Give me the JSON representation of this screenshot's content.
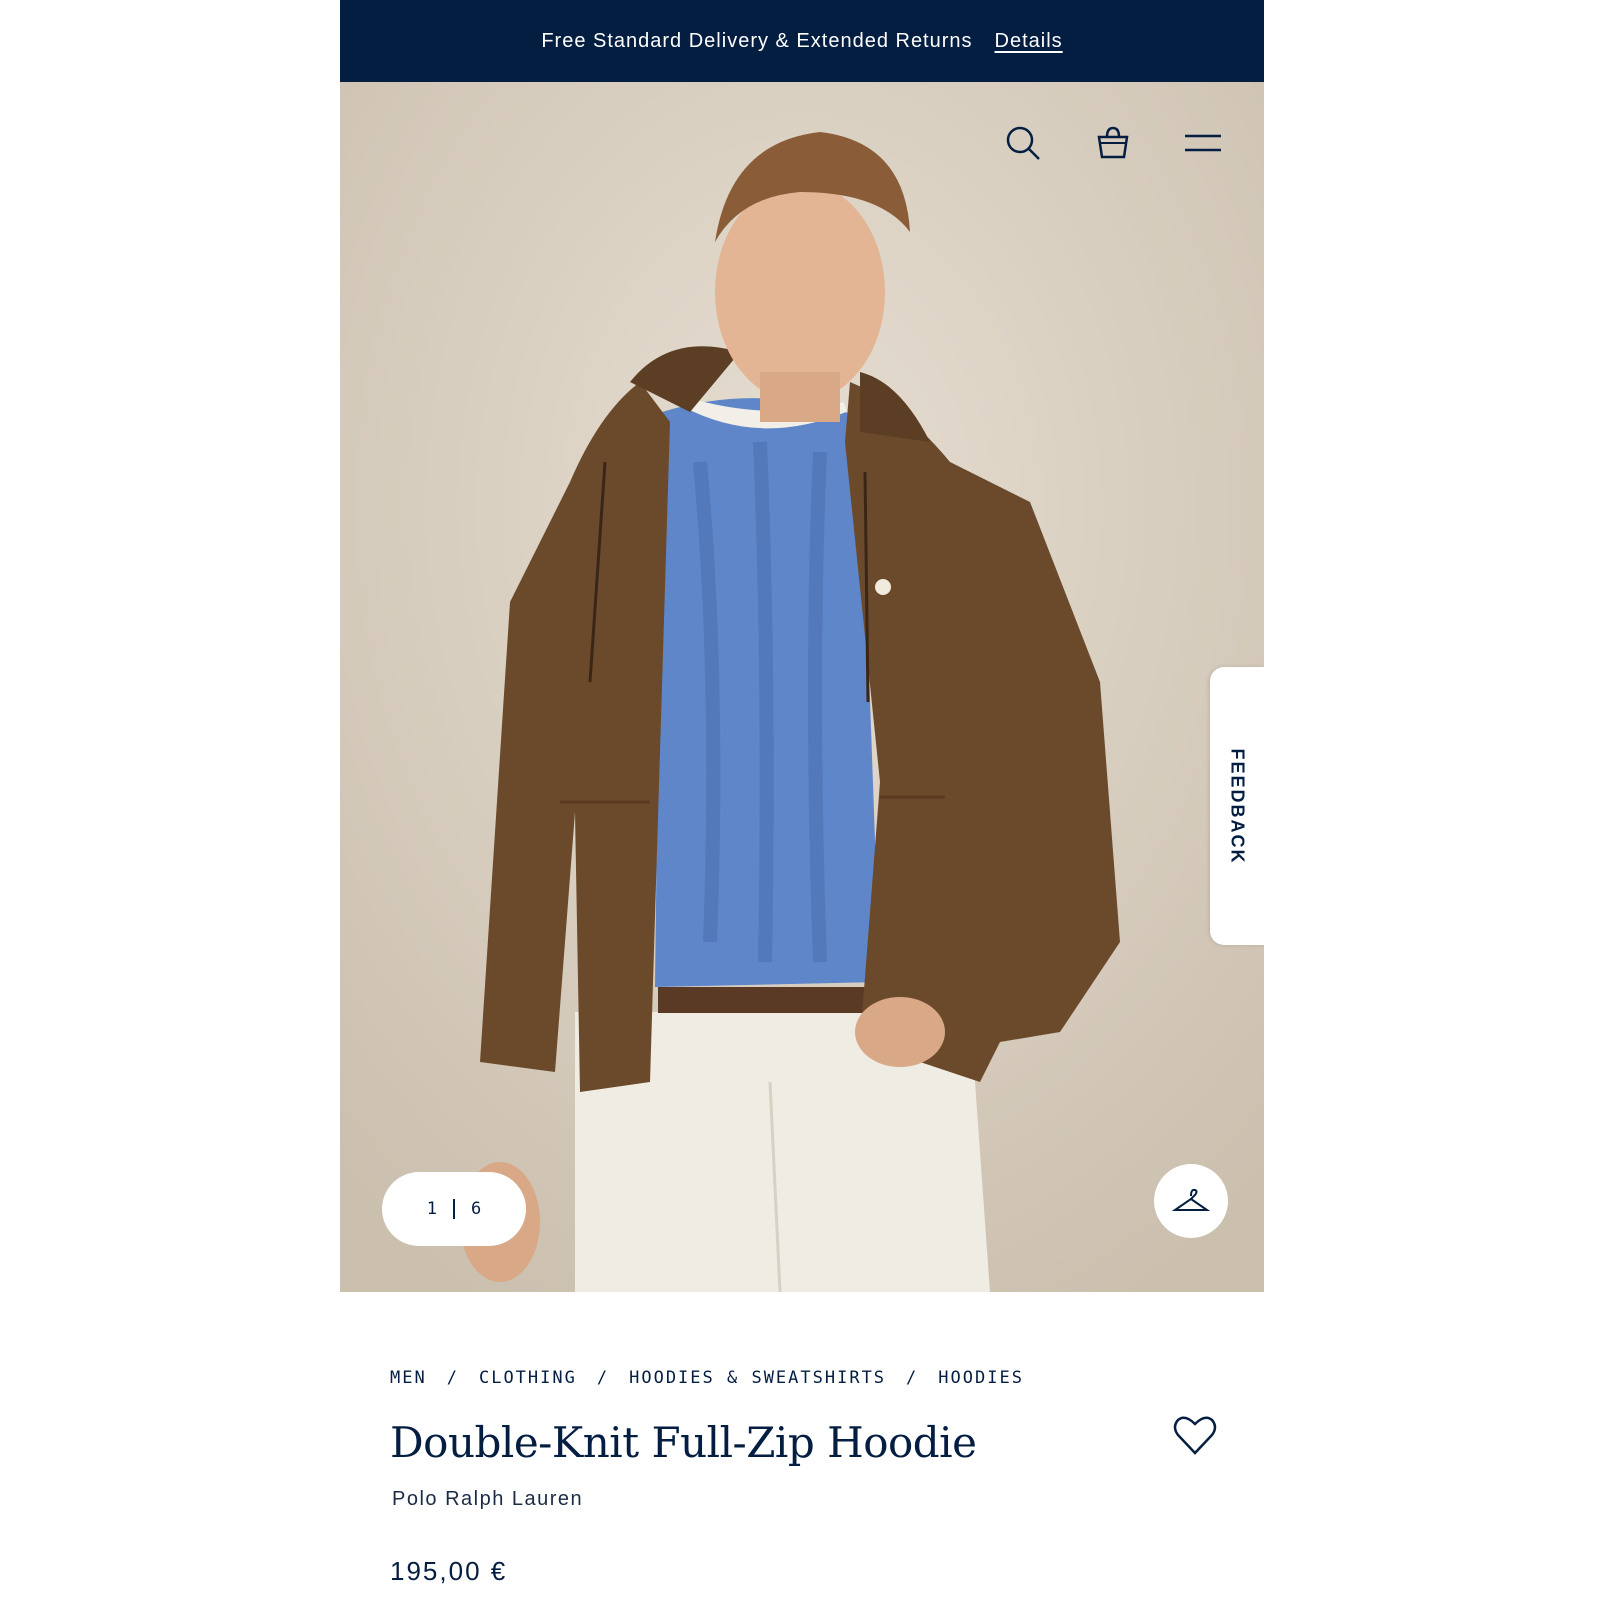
{
  "promo": {
    "text": "Free Standard Delivery & Extended Returns",
    "link": "Details"
  },
  "header": {
    "icons": [
      "search-icon",
      "shopping-bag-icon",
      "menu-icon"
    ]
  },
  "gallery": {
    "current": "1",
    "total": "6",
    "feedback_label": "FEEDBACK",
    "hanger_icon": "hanger-icon"
  },
  "breadcrumb": {
    "items": [
      "MEN",
      "CLOTHING",
      "HOODIES & SWEATSHIRTS",
      "HOODIES"
    ],
    "separator": "/"
  },
  "product": {
    "title": "Double-Knit Full-Zip Hoodie",
    "brand": "Polo Ralph Lauren",
    "price": "195,00 €"
  },
  "colors": {
    "navy": "#041e42",
    "hoodie_brown": "#6b4a2c",
    "sweater_blue": "#5f86c9",
    "background": "#dcd3c6"
  }
}
